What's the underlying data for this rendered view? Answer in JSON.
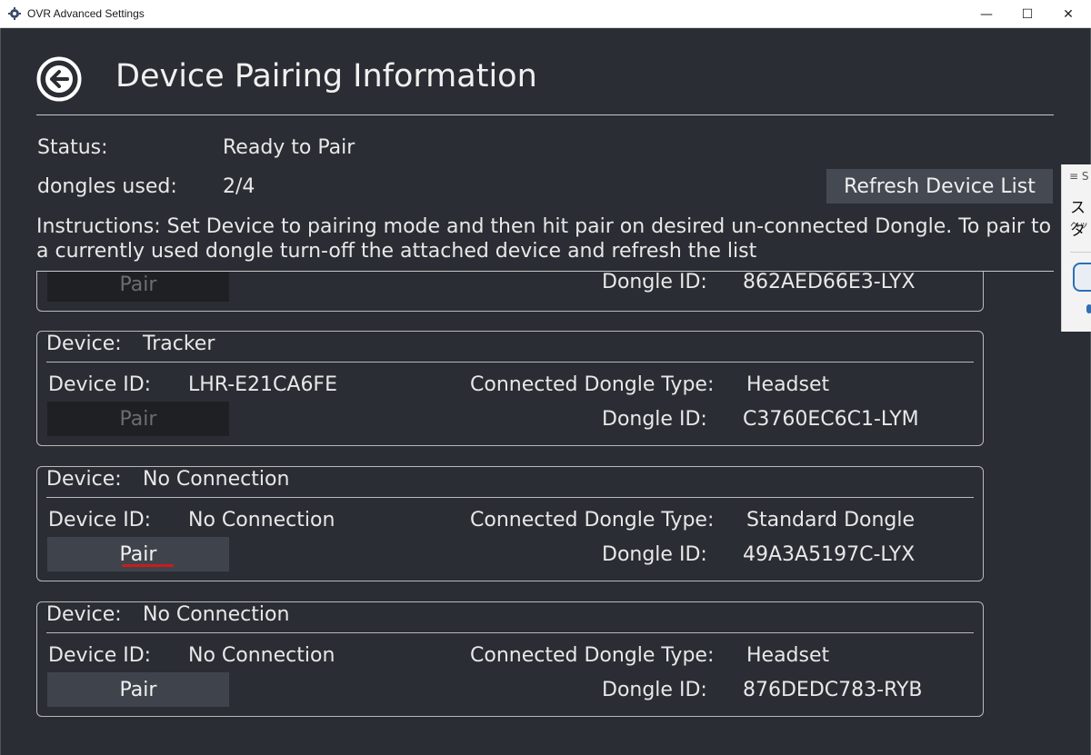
{
  "window": {
    "title": "OVR Advanced Settings",
    "minimize_glyph": "—",
    "maximize_glyph": "☐",
    "close_glyph": "✕"
  },
  "header": {
    "title": "Device Pairing Information",
    "back_icon": "back-arrow-circle-icon"
  },
  "status": {
    "status_label": "Status:",
    "status_value": "Ready to Pair",
    "dongles_label": "dongles used:",
    "dongles_value": "2/4",
    "refresh_label": "Refresh Device List",
    "instructions": "Instructions: Set Device to pairing mode and then hit pair on desired un-connected Dongle. To pair to a currently used dongle turn-off the attached device and refresh the list"
  },
  "labels": {
    "device": "Device:",
    "device_id": "Device ID:",
    "connected_dongle_type": "Connected Dongle Type:",
    "dongle_id": "Dongle ID:",
    "pair": "Pair"
  },
  "partial_card": {
    "pair": "Pair",
    "dongle_id_label": "Dongle ID:",
    "dongle_id": "862AED66E3-LYX"
  },
  "devices": [
    {
      "device": "Tracker",
      "device_id": "LHR-E21CA6FE",
      "dongle_type": "Headset",
      "dongle_id": "C3760EC6C1-LYM",
      "pair_enabled": false
    },
    {
      "device": "No Connection",
      "device_id": "No Connection",
      "dongle_type": "Standard Dongle",
      "dongle_id": "49A3A5197C-LYX",
      "pair_enabled": true
    },
    {
      "device": "No Connection",
      "device_id": "No Connection",
      "dongle_type": "Headset",
      "dongle_id": "876DEDC783-RYB",
      "pair_enabled": true
    }
  ],
  "side_panel": {
    "menu_glyph": "≡ S",
    "title": "スタ",
    "subtitle": "ヘッ"
  },
  "colors": {
    "background": "#2a2d33",
    "button": "#3f444c",
    "button_disabled": "#1e2024",
    "border": "#b9b9b9",
    "highlight_underline": "#cc1b1b"
  }
}
